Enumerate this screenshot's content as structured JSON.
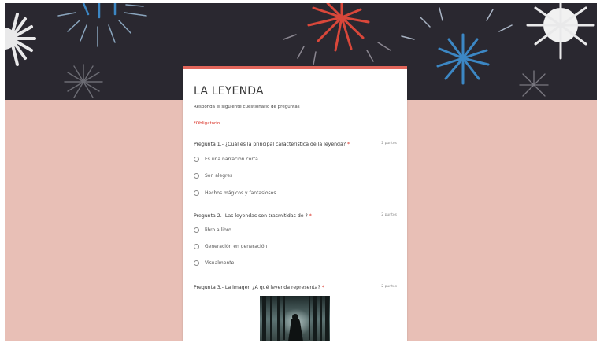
{
  "form": {
    "title": "LA LEYENDA",
    "description": "Responda el siguiente cuestionario de preguntas",
    "required_note": "*Obligatorio",
    "accent_color": "#e2665b",
    "background_color": "#e8bfb6",
    "banner_color": "#2a2830"
  },
  "questions": [
    {
      "title": "Pregunta 1.- ¿Cuál es la principal característica de la leyenda?",
      "required": "*",
      "points": "2 puntos",
      "options": [
        "Es una narración corta",
        "Son alegres",
        "Hechos mágicos y fantasiosos"
      ]
    },
    {
      "title": "Pregunta 2.- Las leyendas son trasmitidas de ?",
      "required": "*",
      "points": "2 puntos",
      "options": [
        "libro a libro",
        "Generación en generación",
        "Visualmente"
      ]
    },
    {
      "title": "Pregunta 3.- La imagen ¿A qué leyenda representa?",
      "required": "*",
      "points": "2 puntos",
      "image": "forest-woman-image"
    }
  ]
}
